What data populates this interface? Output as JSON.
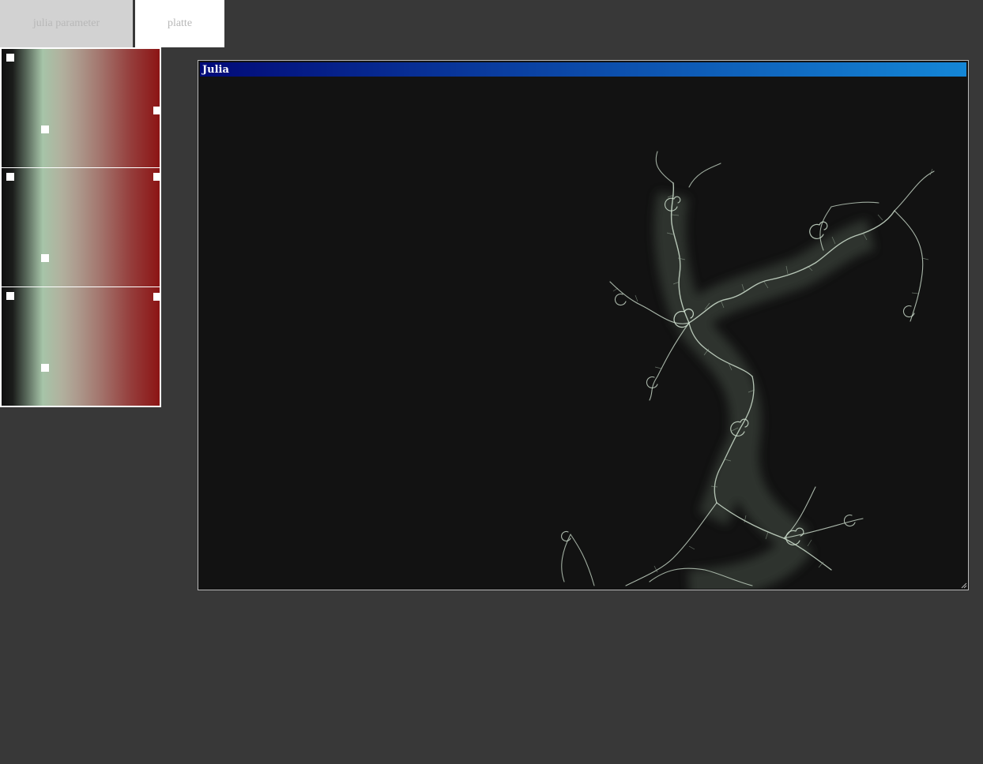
{
  "tabs": [
    {
      "label": "julia parameter",
      "active": false
    },
    {
      "label": "platte",
      "active": true
    }
  ],
  "palette": {
    "channels": [
      "channel-0",
      "channel-1",
      "channel-2"
    ],
    "colors": {
      "dark": "#101010",
      "light_green": "#a6c4a8",
      "red": "#8c1414"
    }
  },
  "window": {
    "title": "Julia",
    "titlebar_colors": [
      "#020a78",
      "#1486d6"
    ],
    "background": "#121212",
    "fractal_color": "#cfe0cf"
  }
}
